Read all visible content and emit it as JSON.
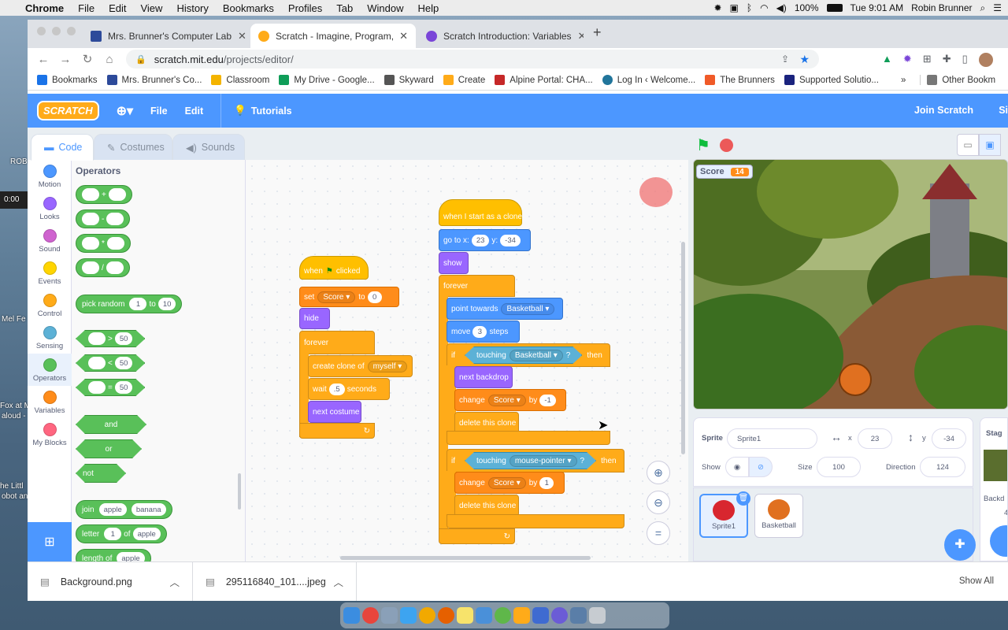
{
  "menubar": {
    "apple": "",
    "app": "Chrome",
    "items": [
      "File",
      "Edit",
      "View",
      "History",
      "Bookmarks",
      "Profiles",
      "Tab",
      "Window",
      "Help"
    ],
    "battery": "100%",
    "clock": "Tue 9:01 AM",
    "user": "Robin Brunner"
  },
  "desktop": {
    "texts": [
      "ROB",
      "0:00",
      "Mel Fe",
      "Fox at M",
      "aloud -",
      "he Littl",
      "obot an"
    ]
  },
  "browser": {
    "tabs": [
      {
        "label": "Mrs. Brunner's Computer Lab",
        "color": "#2d4a9a"
      },
      {
        "label": "Scratch - Imagine, Program, Sh",
        "color": "#ffab19"
      },
      {
        "label": "Scratch Introduction: Variables",
        "color": "#7a45d8"
      }
    ],
    "new_tab": "+",
    "url_domain": "scratch.mit.edu",
    "url_path": "/projects/editor/",
    "bookmarks": [
      {
        "label": "Bookmarks",
        "color": "#1a73e8"
      },
      {
        "label": "Mrs. Brunner's Co...",
        "color": "#2d4a9a"
      },
      {
        "label": "Classroom",
        "color": "#f4b400"
      },
      {
        "label": "My Drive - Google...",
        "color": "#0f9d58"
      },
      {
        "label": "Skyward",
        "color": "#555555"
      },
      {
        "label": "Create",
        "color": "#ffab19"
      },
      {
        "label": "Alpine Portal: CHA...",
        "color": "#c62828"
      },
      {
        "label": "Log In ‹ Welcome...",
        "color": "#21759b"
      },
      {
        "label": "The Brunners",
        "color": "#f05a28"
      },
      {
        "label": "Supported Solutio...",
        "color": "#1a237e"
      }
    ],
    "bookmarks_more": "»",
    "other_bookmarks": "Other Bookm"
  },
  "scratch": {
    "logo": "SCRATCH",
    "menu": [
      "File",
      "Edit"
    ],
    "tutorials": "Tutorials",
    "join": "Join Scratch",
    "sign": "Si",
    "editor_tabs": [
      "Code",
      "Costumes",
      "Sounds"
    ],
    "categories": [
      {
        "label": "Motion",
        "color": "#4c97ff"
      },
      {
        "label": "Looks",
        "color": "#9966ff"
      },
      {
        "label": "Sound",
        "color": "#cf63cf"
      },
      {
        "label": "Events",
        "color": "#ffd500"
      },
      {
        "label": "Control",
        "color": "#ffab19"
      },
      {
        "label": "Sensing",
        "color": "#5cb1d6"
      },
      {
        "label": "Operators",
        "color": "#59c059"
      },
      {
        "label": "Variables",
        "color": "#ff8c1a"
      },
      {
        "label": "My Blocks",
        "color": "#ff6680"
      }
    ],
    "palette_title": "Operators",
    "palette": {
      "plus": "+",
      "minus": "-",
      "times": "*",
      "divide": "/",
      "pick_random": "pick random",
      "pr_a": "1",
      "pr_to": "to",
      "pr_b": "10",
      "gt": ">",
      "lt": "<",
      "eq": "=",
      "cmp_val": "50",
      "and": "and",
      "or": "or",
      "not": "not",
      "join": "join",
      "apple": "apple",
      "banana": "banana",
      "letter": "letter",
      "letter_n": "1",
      "of": "of",
      "length_of": "length of"
    },
    "script1": {
      "when": "when",
      "clicked": "clicked",
      "set": "set",
      "var": "Score",
      "to": "to",
      "to_val": "0",
      "hide": "hide",
      "forever": "forever",
      "create_clone": "create clone of",
      "myself": "myself",
      "wait": "wait",
      "wait_val": ".5",
      "seconds": "seconds",
      "next_costume": "next costume"
    },
    "script2": {
      "hat": "when I start as a clone",
      "goto": "go to x:",
      "x": "23",
      "y_label": "y:",
      "y": "-34",
      "show": "show",
      "forever": "forever",
      "point": "point towards",
      "target": "Basketball",
      "move": "move",
      "steps_val": "3",
      "steps": "steps",
      "if": "if",
      "touching": "touching",
      "q": "?",
      "then": "then",
      "next_backdrop": "next backdrop",
      "change": "change",
      "by": "by",
      "by_val1": "-1",
      "delete": "delete this clone",
      "mouse": "mouse-pointer",
      "by_val2": "1"
    },
    "stage": {
      "monitor_label": "Score",
      "monitor_value": "14"
    },
    "sprite_info": {
      "sprite_label": "Sprite",
      "sprite_name": "Sprite1",
      "x_label": "x",
      "x": "23",
      "y_label": "y",
      "y": "-34",
      "show_label": "Show",
      "size_label": "Size",
      "size": "100",
      "direction_label": "Direction",
      "direction": "124"
    },
    "sprites": [
      "Sprite1",
      "Basketball"
    ],
    "stage_panel": {
      "label": "Stag",
      "backdrops_label": "Backd",
      "backdrops_count": "4"
    }
  },
  "downloads": {
    "items": [
      "Background.png",
      "295116840_101....jpeg"
    ],
    "show_all": "Show All"
  }
}
